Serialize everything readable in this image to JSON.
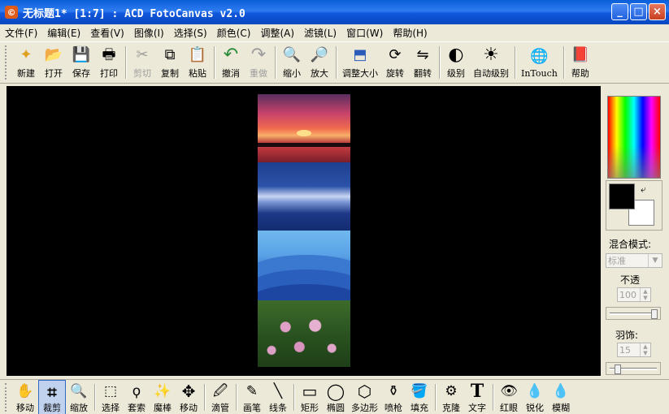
{
  "window": {
    "title": "无标题1* [1:7] : ACD FotoCanvas v2.0",
    "app_icon": "©"
  },
  "title_buttons": {
    "minimize": "_",
    "maximize": "□",
    "close": "×"
  },
  "menu": [
    {
      "label": "文件(F)"
    },
    {
      "label": "编辑(E)"
    },
    {
      "label": "查看(V)"
    },
    {
      "label": "图像(I)"
    },
    {
      "label": "选择(S)"
    },
    {
      "label": "颜色(C)"
    },
    {
      "label": "调整(A)"
    },
    {
      "label": "滤镜(L)"
    },
    {
      "label": "窗口(W)"
    },
    {
      "label": "帮助(H)"
    }
  ],
  "toolbar": {
    "new": {
      "label": "新建",
      "icon": "new-file-icon",
      "glyph": "✦"
    },
    "open": {
      "label": "打开",
      "icon": "open-folder-icon",
      "glyph": "📂"
    },
    "save": {
      "label": "保存",
      "icon": "floppy-disk-icon",
      "glyph": "💾"
    },
    "print": {
      "label": "打印",
      "icon": "printer-icon",
      "glyph": "🖶"
    },
    "cut": {
      "label": "剪切",
      "icon": "scissors-icon",
      "glyph": "✂"
    },
    "copy": {
      "label": "复制",
      "icon": "copy-icon",
      "glyph": "⧉"
    },
    "paste": {
      "label": "粘贴",
      "icon": "clipboard-icon",
      "glyph": "📋"
    },
    "undo": {
      "label": "撤消",
      "icon": "undo-arrow-icon",
      "glyph": "↶"
    },
    "redo": {
      "label": "重做",
      "icon": "redo-arrow-icon",
      "glyph": "↷"
    },
    "zoom_out": {
      "label": "缩小",
      "icon": "zoom-out-icon",
      "glyph": "🔍"
    },
    "zoom_in": {
      "label": "放大",
      "icon": "zoom-in-icon",
      "glyph": "🔎"
    },
    "resize": {
      "label": "调整大小",
      "icon": "resize-icon",
      "glyph": "⬒"
    },
    "rotate": {
      "label": "旋转",
      "icon": "rotate-icon",
      "glyph": "⟳"
    },
    "flip": {
      "label": "翻转",
      "icon": "flip-icon",
      "glyph": "⇋"
    },
    "levels": {
      "label": "级别",
      "icon": "levels-icon",
      "glyph": "◐"
    },
    "auto_levels": {
      "label": "自动级别",
      "icon": "auto-levels-icon",
      "glyph": "☀"
    },
    "intouch": {
      "label": "InTouch",
      "icon": "globe-icon",
      "glyph": "🌐"
    },
    "help": {
      "label": "帮助",
      "icon": "help-book-icon",
      "glyph": "📕"
    }
  },
  "right_panel": {
    "blend_mode_label": "混合模式:",
    "blend_mode_value": "标准",
    "opacity_label": "不透",
    "opacity_value": "100",
    "opacity_fraction": 0.95,
    "feather_label": "羽饰:",
    "feather_value": "15",
    "feather_fraction": 0.15,
    "foreground_color": "#000000",
    "background_color": "#ffffff",
    "swap_glyph": "⤶"
  },
  "bottom_tools": {
    "move": {
      "label": "移动",
      "glyph": "✋"
    },
    "crop": {
      "label": "裁剪",
      "glyph": "⌗"
    },
    "zoom": {
      "label": "缩放",
      "glyph": "🔍"
    },
    "select": {
      "label": "选择",
      "glyph": "⬚"
    },
    "lasso": {
      "label": "套索",
      "glyph": "ϙ"
    },
    "magic_wand": {
      "label": "魔棒",
      "glyph": "✨"
    },
    "move_selection": {
      "label": "移动",
      "glyph": "✥"
    },
    "eyedropper": {
      "label": "滴管",
      "glyph": "🖉"
    },
    "pencil": {
      "label": "画笔",
      "glyph": "✎"
    },
    "line": {
      "label": "线条",
      "glyph": "╲"
    },
    "rectangle": {
      "label": "矩形",
      "glyph": "▭"
    },
    "ellipse": {
      "label": "椭圆",
      "glyph": "◯"
    },
    "polygon": {
      "label": "多边形",
      "glyph": "⬡"
    },
    "airbrush": {
      "label": "喷枪",
      "glyph": "⚱"
    },
    "fill": {
      "label": "填充",
      "glyph": "🪣"
    },
    "clone": {
      "label": "克隆",
      "glyph": "⚙"
    },
    "text": {
      "label": "文字",
      "glyph": "T"
    },
    "red_eye": {
      "label": "红眼",
      "glyph": "👁"
    },
    "sharpen": {
      "label": "锐化",
      "glyph": "💧"
    },
    "blur": {
      "label": "模糊",
      "glyph": "💧"
    }
  }
}
